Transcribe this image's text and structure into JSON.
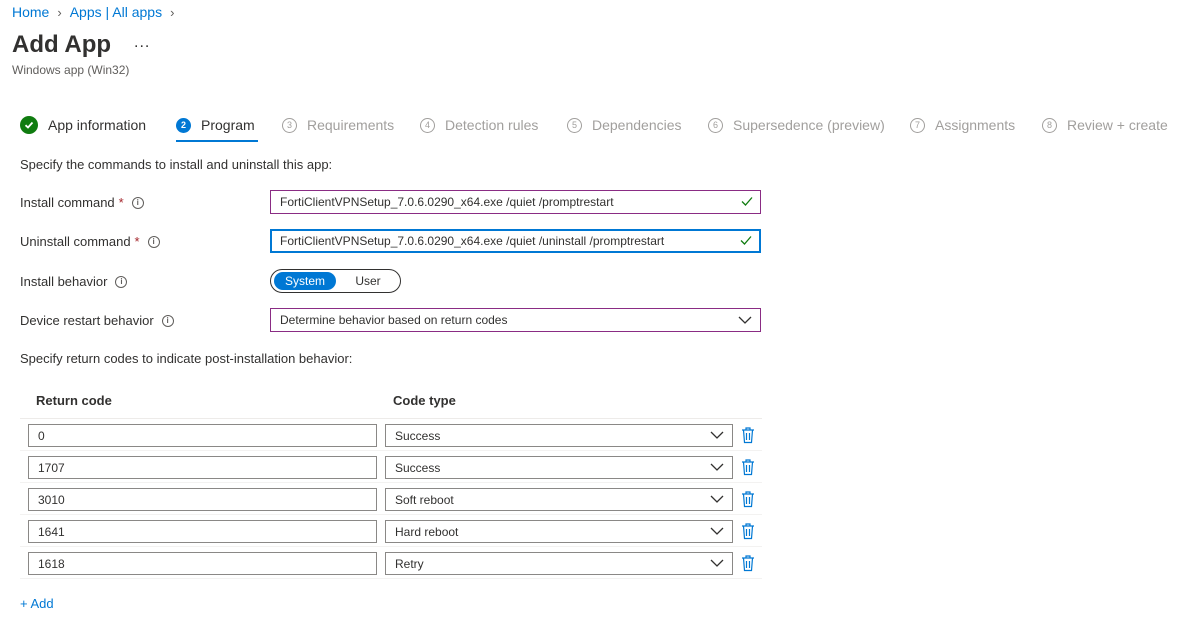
{
  "breadcrumb": {
    "home": "Home",
    "apps": "Apps | All apps"
  },
  "header": {
    "title": "Add App",
    "more": "...",
    "subtitle": "Windows app (Win32)"
  },
  "steps": [
    {
      "num": "",
      "label": "App information",
      "state": "done"
    },
    {
      "num": "2",
      "label": "Program",
      "state": "active"
    },
    {
      "num": "3",
      "label": "Requirements",
      "state": "todo"
    },
    {
      "num": "4",
      "label": "Detection rules",
      "state": "todo"
    },
    {
      "num": "5",
      "label": "Dependencies",
      "state": "todo"
    },
    {
      "num": "6",
      "label": "Supersedence (preview)",
      "state": "todo"
    },
    {
      "num": "7",
      "label": "Assignments",
      "state": "todo"
    },
    {
      "num": "8",
      "label": "Review + create",
      "state": "todo"
    }
  ],
  "form": {
    "intro": "Specify the commands to install and uninstall this app:",
    "install_label": "Install command",
    "install_value": "FortiClientVPNSetup_7.0.6.0290_x64.exe /quiet /promptrestart",
    "uninstall_label": "Uninstall command",
    "uninstall_value": "FortiClientVPNSetup_7.0.6.0290_x64.exe /quiet /uninstall /promptrestart",
    "required_mark": "*",
    "info_glyph": "i",
    "behavior_label": "Install behavior",
    "behavior_options": [
      "System",
      "User"
    ],
    "behavior_selected": "System",
    "restart_label": "Device restart behavior",
    "restart_value": "Determine behavior based on return codes",
    "return_intro": "Specify return codes to indicate post-installation behavior:"
  },
  "return_codes": {
    "col_code": "Return code",
    "col_type": "Code type",
    "rows": [
      {
        "code": "0",
        "type": "Success"
      },
      {
        "code": "1707",
        "type": "Success"
      },
      {
        "code": "3010",
        "type": "Soft reboot"
      },
      {
        "code": "1641",
        "type": "Hard reboot"
      },
      {
        "code": "1618",
        "type": "Retry"
      }
    ],
    "add_label": "+ Add"
  },
  "colors": {
    "accent": "#0078d4",
    "success": "#107c10",
    "required": "#a4262c",
    "field_border": "#8a2c84"
  },
  "icons": {
    "done_step": "checkmark-circle-icon",
    "valid": "checkmark-icon",
    "dropdown": "chevron-down-icon",
    "delete": "trash-icon",
    "info": "info-icon"
  }
}
